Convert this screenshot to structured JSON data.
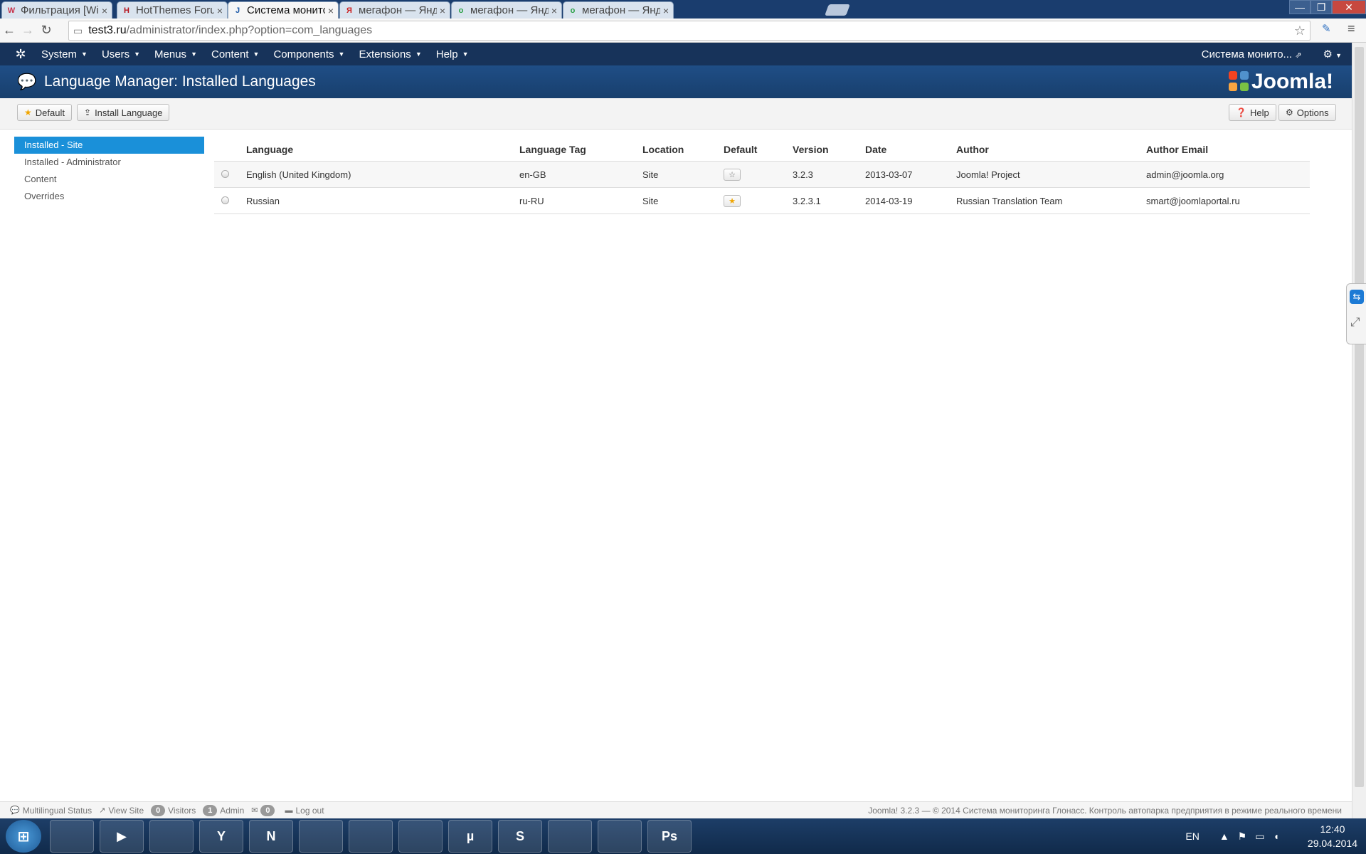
{
  "browser": {
    "tabs": [
      {
        "label": "Фильтрация [Wialon",
        "favicon": "W",
        "color": "#c8324a"
      },
      {
        "label": "HotThemes Forum ::",
        "favicon": "H",
        "color": "#b5121b"
      },
      {
        "label": "Система мониторин",
        "favicon": "J",
        "color": "#1e5aa8"
      },
      {
        "label": "мегафон — Яндекс",
        "favicon": "Я",
        "color": "#cc2222"
      },
      {
        "label": "мегафон — Яндекс",
        "favicon": "o",
        "color": "#2aa046"
      },
      {
        "label": "мегафон — Яндекс",
        "favicon": "o",
        "color": "#2aa046"
      }
    ],
    "close_glyph": "×",
    "address": {
      "host": "test3.ru",
      "path": "/administrator/index.php?option=com_languages"
    }
  },
  "joomla": {
    "menu": [
      {
        "label": "System"
      },
      {
        "label": "Users"
      },
      {
        "label": "Menus"
      },
      {
        "label": "Content"
      },
      {
        "label": "Components"
      },
      {
        "label": "Extensions"
      },
      {
        "label": "Help"
      }
    ],
    "site_link": "Система монито...",
    "page_title": "Language Manager: Installed Languages",
    "brand": "Joomla!",
    "toolbar": {
      "default_label": "Default",
      "install_label": "Install Language",
      "help_label": "Help",
      "options_label": "Options"
    },
    "sidebar": [
      {
        "label": "Installed - Site",
        "active": true
      },
      {
        "label": "Installed - Administrator"
      },
      {
        "label": "Content"
      },
      {
        "label": "Overrides"
      }
    ],
    "table": {
      "headers": [
        "Language",
        "Language Tag",
        "Location",
        "Default",
        "Version",
        "Date",
        "Author",
        "Author Email"
      ],
      "rows": [
        {
          "language": "English (United Kingdom)",
          "tag": "en-GB",
          "location": "Site",
          "default": false,
          "version": "3.2.3",
          "date": "2013-03-07",
          "author": "Joomla! Project",
          "email": "admin@joomla.org"
        },
        {
          "language": "Russian",
          "tag": "ru-RU",
          "location": "Site",
          "default": true,
          "version": "3.2.3.1",
          "date": "2014-03-19",
          "author": "Russian Translation Team",
          "email": "smart@joomlaportal.ru"
        }
      ]
    },
    "status": {
      "multilingual": "Multilingual Status",
      "view_site": "View Site",
      "visitors_count": "0",
      "visitors_label": "Visitors",
      "admin_count": "1",
      "admin_label": "Admin",
      "messages_count": "0",
      "logout": "Log out",
      "footer": "Joomla! 3.2.3 — © 2014 Система мониторинга Глонасс. Контроль автопарка предприятия в режиме реального времени"
    }
  },
  "taskbar": {
    "apps": [
      "explorer",
      "media-player",
      "opera",
      "yandex-browser",
      "onenote",
      "thunderbird",
      "save-disk",
      "chrome",
      "utorrent",
      "skype",
      "icq",
      "teamviewer",
      "photoshop"
    ],
    "app_glyphs": [
      "",
      "▶",
      "",
      "Y",
      "N",
      "",
      "",
      "",
      "µ",
      "S",
      "",
      "",
      "Ps"
    ],
    "lang": "EN",
    "time": "12:40",
    "date": "29.04.2014"
  }
}
